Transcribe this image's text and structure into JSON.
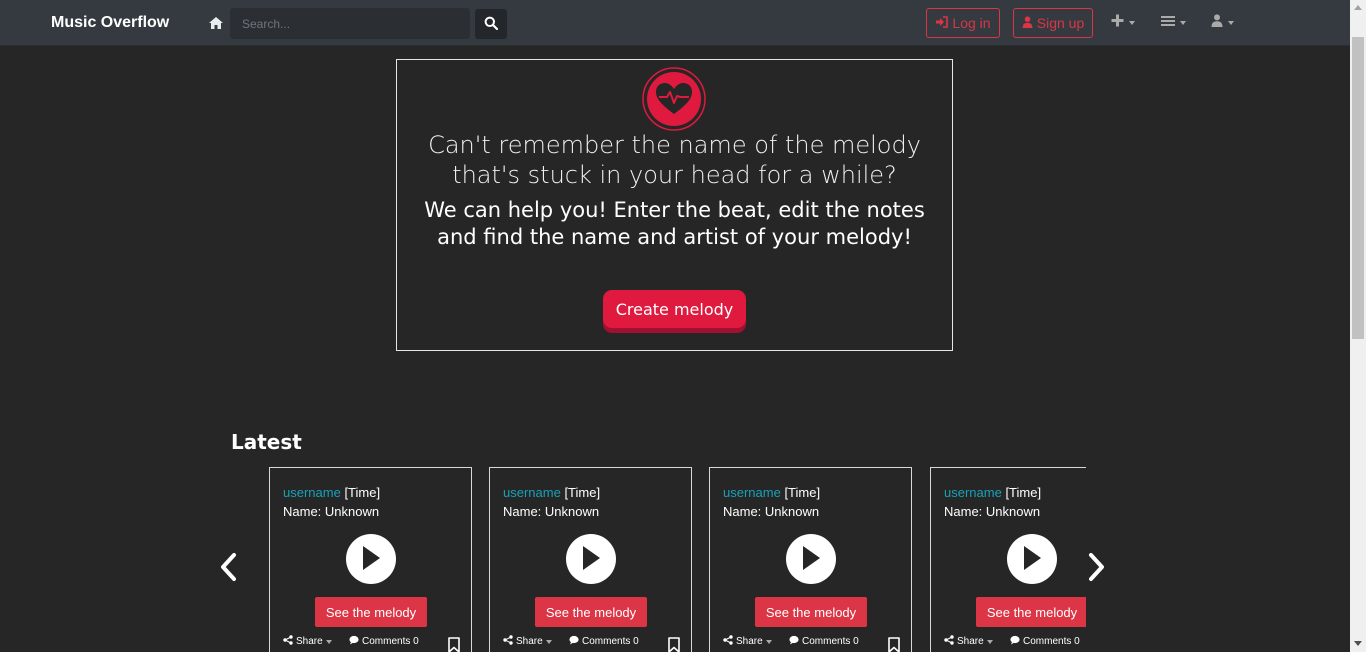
{
  "navbar": {
    "brand": "Music Overflow",
    "search_placeholder": "Search...",
    "login_label": "Log in",
    "signup_label": "Sign up",
    "icons": [
      "home-icon",
      "search-icon",
      "sign-in-icon",
      "user-icon",
      "plus-icon",
      "menu-icon",
      "user-icon"
    ]
  },
  "hero": {
    "question": "Can't remember the name of the melody that's stuck in your head for a while?",
    "subtitle": "We can help you! Enter the beat, edit the notes and find the name and artist of your melody!",
    "cta_label": "Create melody",
    "logo_icon": "heartbeat-icon"
  },
  "latest": {
    "title": "Latest",
    "cards": [
      {
        "username": "username",
        "time": "[Time]",
        "name": "Name: Unknown",
        "see_label": "See the melody",
        "share_label": "Share",
        "comments_label": "Comments 0"
      },
      {
        "username": "username",
        "time": "[Time]",
        "name": "Name: Unknown",
        "see_label": "See the melody",
        "share_label": "Share",
        "comments_label": "Comments 0"
      },
      {
        "username": "username",
        "time": "[Time]",
        "name": "Name: Unknown",
        "see_label": "See the melody",
        "share_label": "Share",
        "comments_label": "Comments 0"
      },
      {
        "username": "username",
        "time": "[Time]",
        "name": "Name: Unknown",
        "see_label": "See the melody",
        "share_label": "Share",
        "comments_label": "Comments 0"
      }
    ]
  },
  "colors": {
    "background": "#262626",
    "navbar": "#343a40",
    "accent_red": "#dc3545",
    "cta_red": "#e0193f",
    "link_teal": "#17a2b8"
  }
}
